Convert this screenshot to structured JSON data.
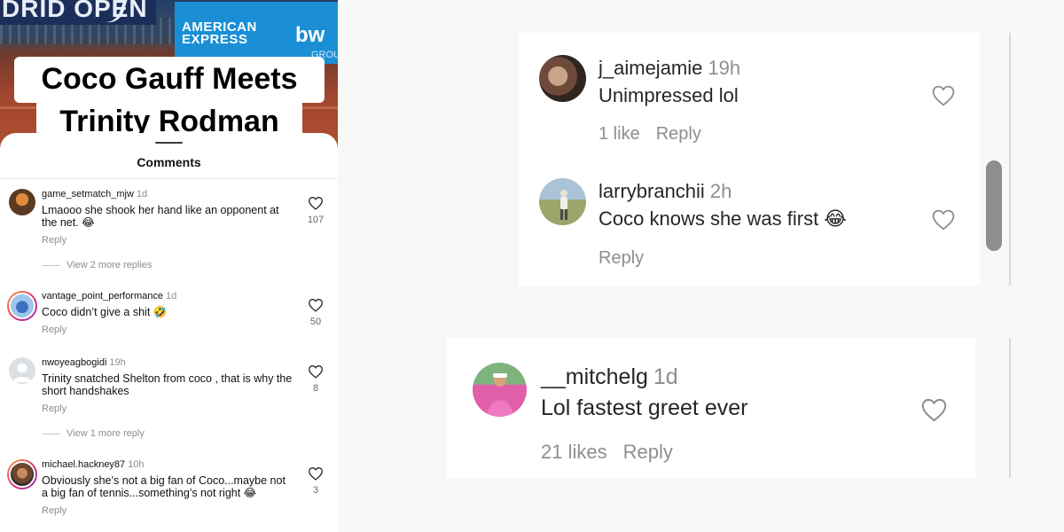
{
  "video": {
    "banner_text": "DRID OPEN",
    "board_brand": "AMERICAN\nEXPRESS",
    "board_logo": "bw",
    "board_extra": "GROUP",
    "title_line_1": "Coco Gauff Meets",
    "title_line_2": "Trinity Rodman"
  },
  "left_comments": {
    "title": "Comments",
    "items": [
      {
        "user": "game_setmatch_mjw",
        "time": "1d",
        "text": "Lmaooo she shook her hand like an opponent at the net. 😂",
        "reply": "Reply",
        "likes": "107",
        "view_more": "View 2 more replies",
        "avatar": "orange-dark-avatar"
      },
      {
        "user": "vantage_point_performance",
        "time": "1d",
        "text": "Coco didn’t give a shit 🤣",
        "reply": "Reply",
        "likes": "50",
        "avatar": "tennis-player-avatar"
      },
      {
        "user": "nwoyeagbogidi",
        "time": "19h",
        "text": "Trinity snatched Shelton from coco , that is why the short handshakes",
        "reply": "Reply",
        "likes": "8",
        "view_more": "View 1 more reply",
        "avatar": "default-user-avatar"
      },
      {
        "user": "michael.hackney87",
        "time": "10h",
        "text": "Obviously she’s not a big fan of Coco...maybe not a big fan of tennis...something’s not right 😂",
        "reply": "Reply",
        "likes": "3",
        "avatar": "bearded-man-avatar"
      }
    ]
  },
  "right_comments": [
    {
      "user": "j_aimejamie",
      "time": "19h",
      "text": "Unimpressed lol",
      "likes": "1 like",
      "reply": "Reply"
    },
    {
      "user": "larrybranchii",
      "time": "2h",
      "text": "Coco knows she was first 😂",
      "reply": "Reply"
    },
    {
      "user": "__mitchelg",
      "time": "1d",
      "text": "Lol fastest greet ever",
      "likes": "21 likes",
      "reply": "Reply"
    }
  ],
  "colors": {
    "sheet_bg": "#ffffff",
    "page_bg": "#f8f8f6",
    "muted_text": "#8e8e8e",
    "story_ring": "#d62a7b"
  }
}
